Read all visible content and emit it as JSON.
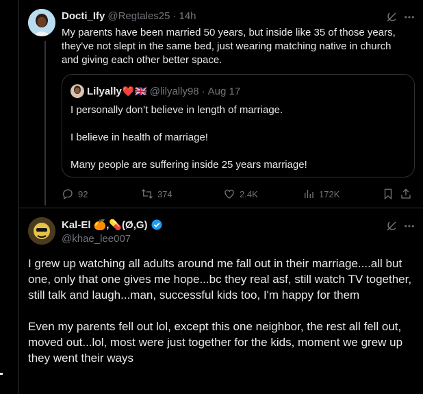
{
  "tweet1": {
    "author_name": "Docti_Ify",
    "handle": "@Regtales25",
    "time_sep": "·",
    "time": "14h",
    "text": "My parents have been married 50 years, but inside like 35 of those years, they've not slept in the same bed, just wearing matching native in church and giving each other better space."
  },
  "quoted": {
    "author_name": "Lilyally",
    "emoji": "❤️",
    "flag": "🇬🇧",
    "handle": "@lilyally98",
    "time_sep": "·",
    "date": "Aug 17",
    "line1": "I personally don’t believe in length of marriage.",
    "line2": "I believe in health of marriage!",
    "line3": "Many people are suffering inside 25 years marriage!"
  },
  "actions": {
    "replies": "92",
    "reposts": "374",
    "likes": "2.4K",
    "views": "172K"
  },
  "tweet2": {
    "author_name": "Kal-El",
    "name_suffix": "🍊,💊(Ø,G)",
    "handle": "@khae_lee007",
    "paragraph1": "I grew up watching all adults around me fall out in their marriage....all but one, only that one gives me hope...bc they real asf, still watch TV together, still talk and laugh...man, successful kids too, I'm happy for them",
    "paragraph2": "Even my parents fell out lol, except this one neighbor, the rest all fell out, moved out...lol, most were just together for the kids, moment we grew up they went their ways"
  },
  "colors": {
    "background": "#000000",
    "text": "#e7e9ea",
    "muted": "#71767b",
    "border": "#2f3336",
    "verified": "#1d9bf0"
  },
  "icons": [
    "grok-icon",
    "more-icon",
    "reply-icon",
    "repost-icon",
    "like-icon",
    "views-icon",
    "bookmark-icon",
    "share-icon",
    "verified-badge-icon"
  ]
}
